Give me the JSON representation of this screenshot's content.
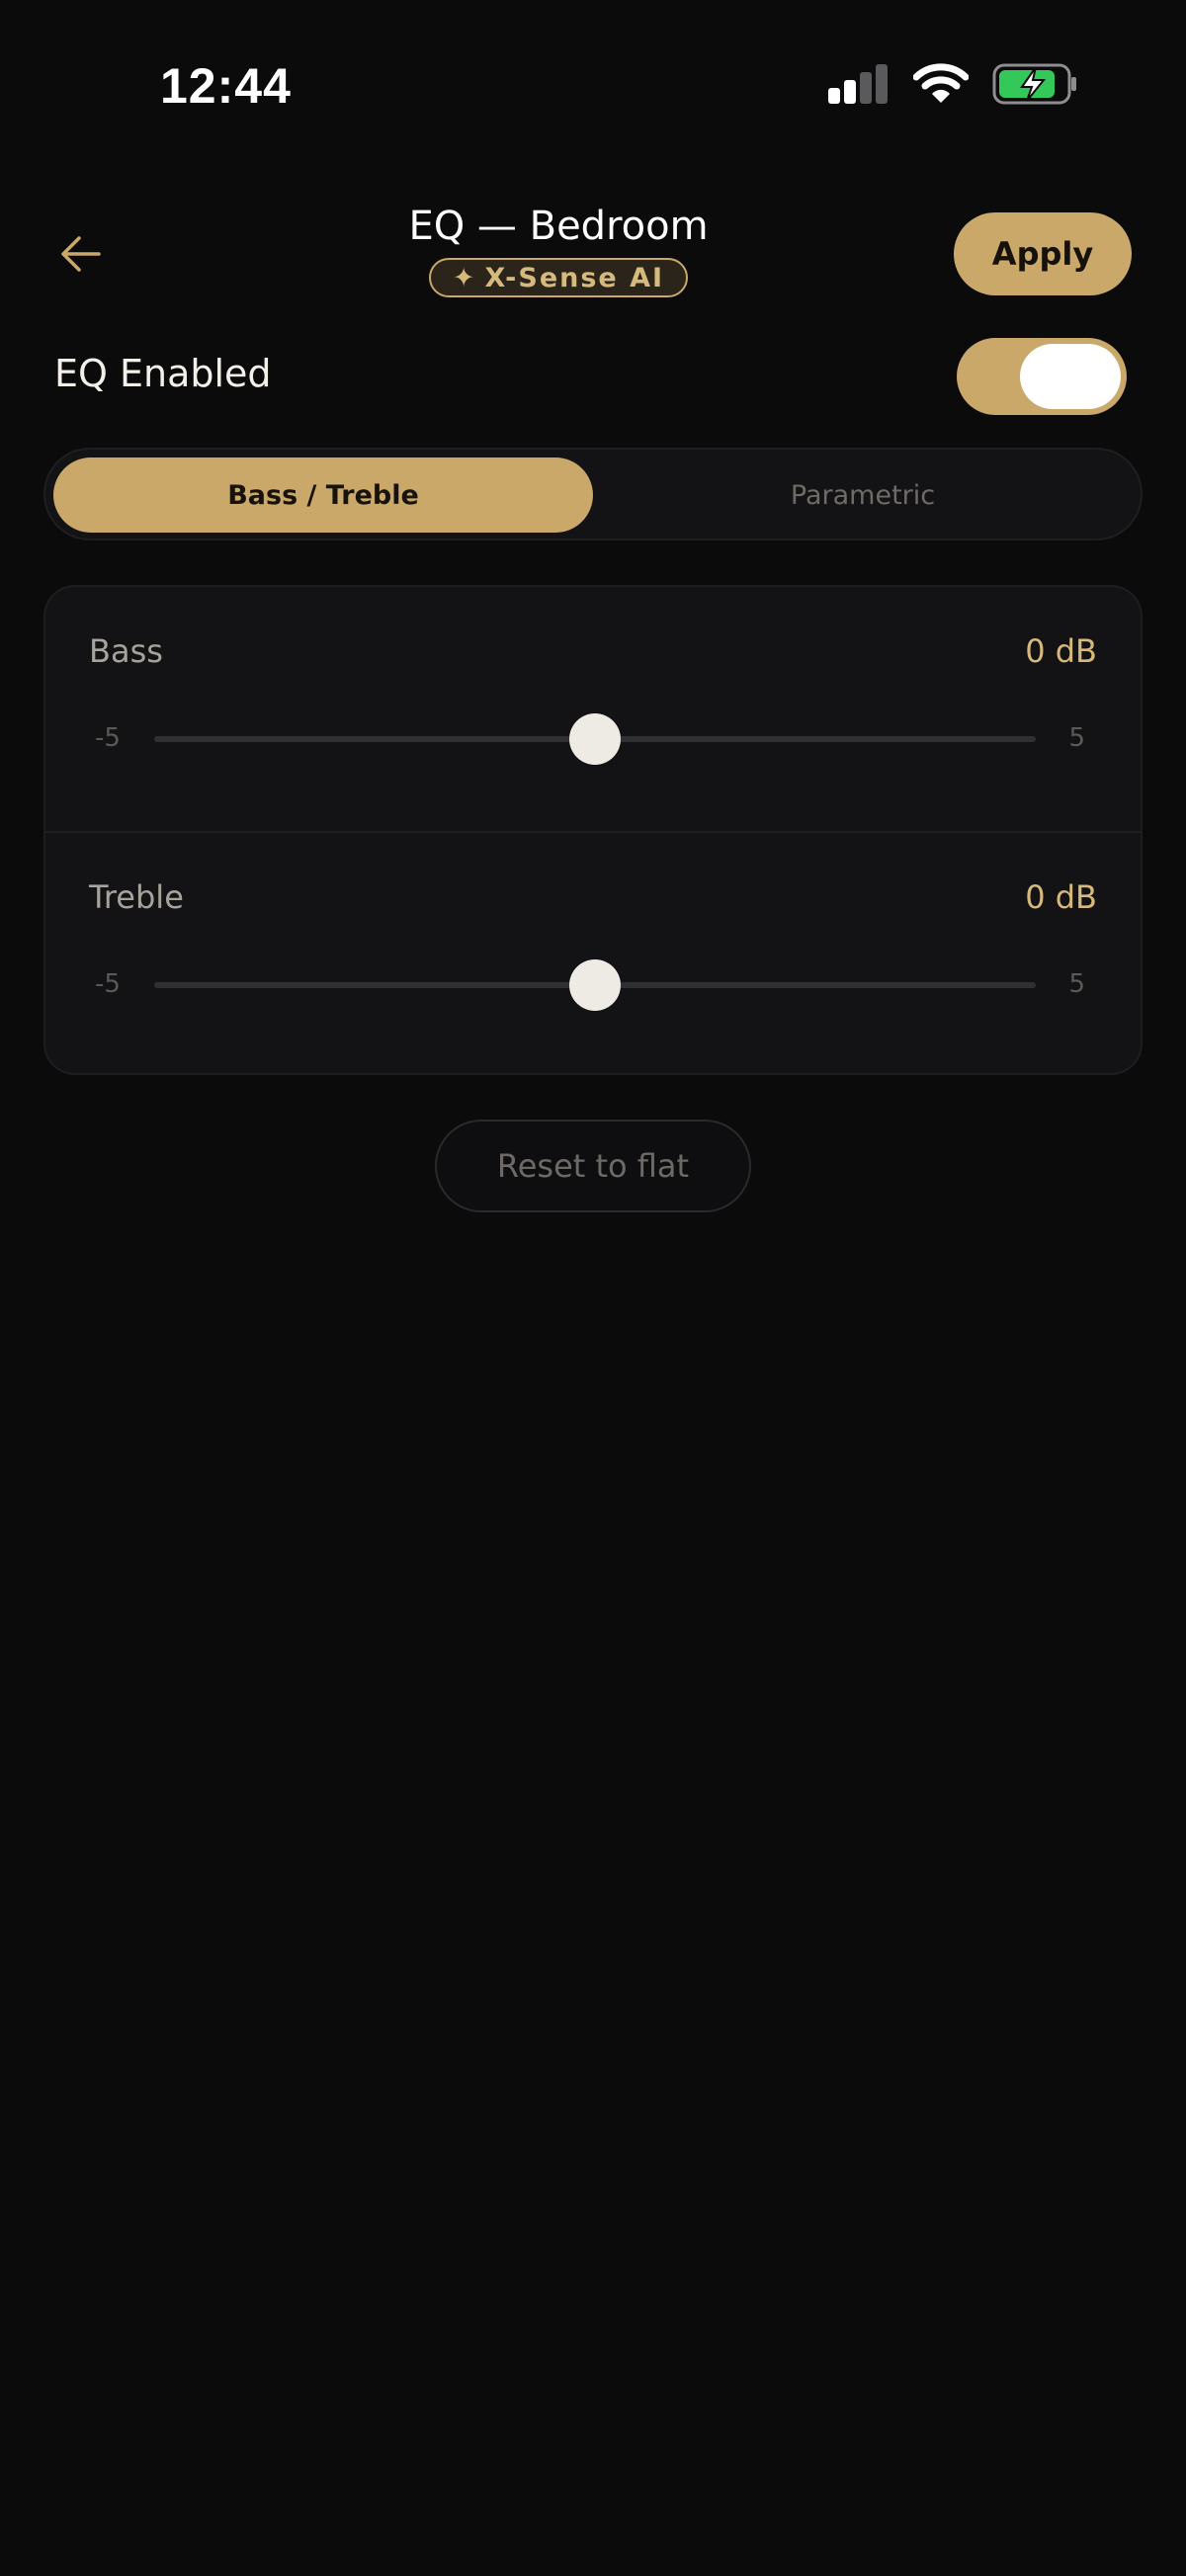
{
  "status_bar": {
    "time": "12:44",
    "icons": [
      "signal-icon",
      "wifi-icon",
      "battery-charging-icon"
    ]
  },
  "header": {
    "back_icon": "arrow-left-icon",
    "title": "EQ — Bedroom",
    "badge": {
      "icon": "sparkle-icon",
      "glyph": "✦",
      "label": "X-Sense AI"
    },
    "apply_label": "Apply"
  },
  "eq_toggle": {
    "label": "EQ Enabled",
    "enabled": true
  },
  "mode_tabs": [
    {
      "label": "Bass / Treble",
      "active": true
    },
    {
      "label": "Parametric",
      "active": false
    }
  ],
  "sliders": {
    "bass": {
      "label": "Bass",
      "value_text": "0 dB",
      "value": 0,
      "min": -5,
      "max": 5,
      "min_label": "-5",
      "max_label": "5"
    },
    "treble": {
      "label": "Treble",
      "value_text": "0 dB",
      "value": 0,
      "min": -5,
      "max": 5,
      "min_label": "-5",
      "max_label": "5"
    }
  },
  "reset_label": "Reset to flat",
  "colors": {
    "background": "#0b0b0c",
    "accent": "#c9a86a",
    "card": "#131315",
    "battery_green": "#34c759"
  }
}
